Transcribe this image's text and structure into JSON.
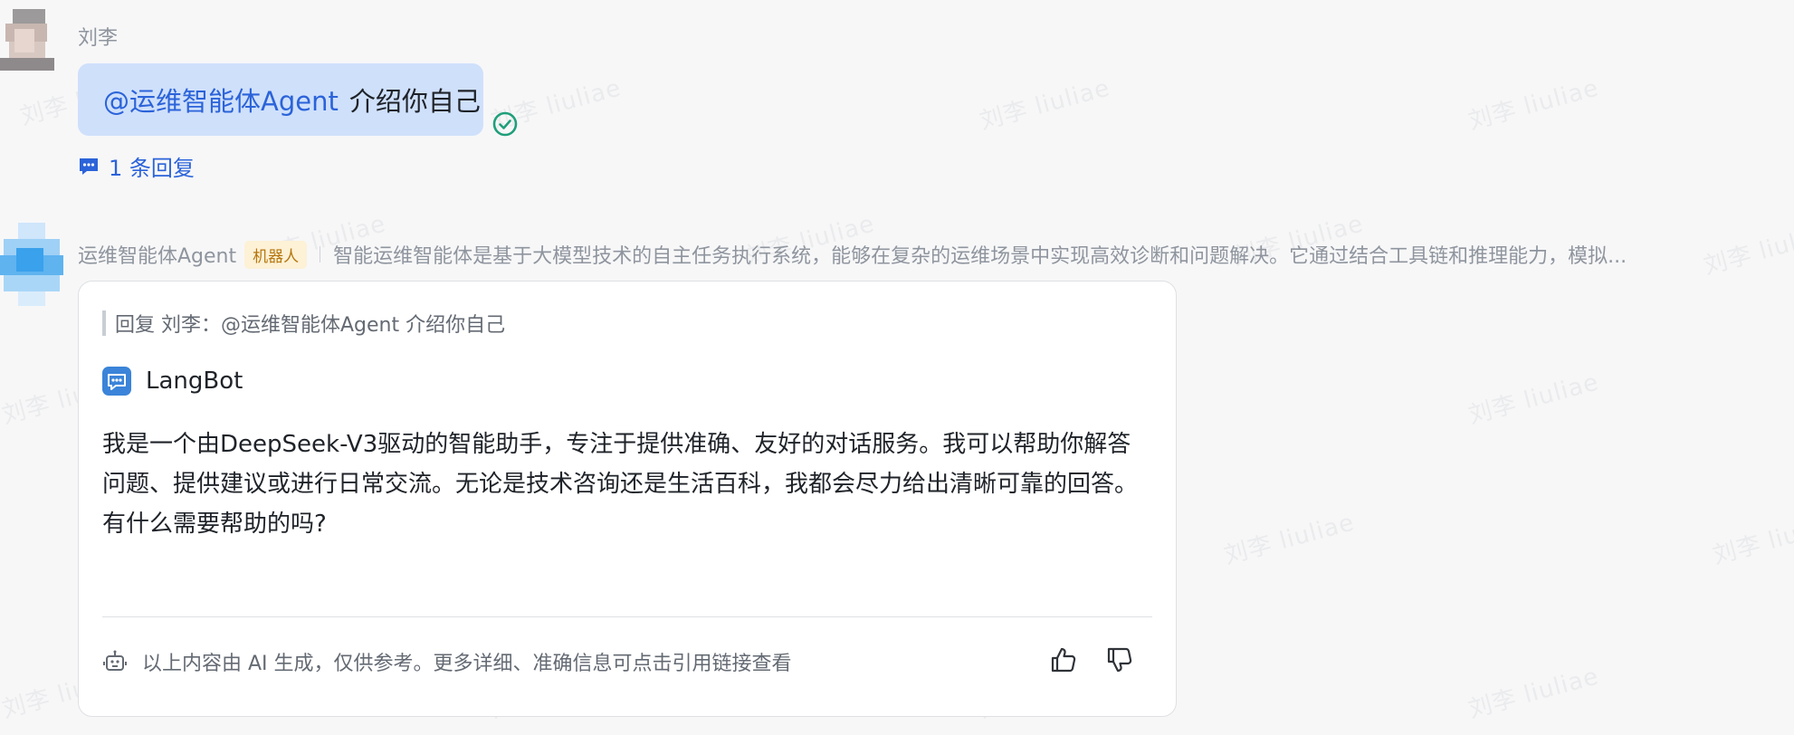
{
  "watermark": "刘李 liuliae",
  "message_user": {
    "sender": "刘李",
    "mention": "@运维智能体Agent",
    "text": "介绍你自己",
    "reply_count_label": "1 条回复"
  },
  "message_bot": {
    "name": "运维智能体Agent",
    "tag": "机器人",
    "preview": "智能运维智能体是基于大模型技术的自主任务执行系统，能够在复杂的运维场景中实现高效诊断和问题解决。它通过结合工具链和推理能力，模拟...",
    "card": {
      "quote": "回复 刘李：@运维智能体Agent 介绍你自己",
      "title": "LangBot",
      "body": "我是一个由DeepSeek-V3驱动的智能助手，专注于提供准确、友好的对话服务。我可以帮助你解答问题、提供建议或进行日常交流。无论是技术咨询还是生活百科，我都会尽力给出清晰可靠的回答。有什么需要帮助的吗?",
      "disclaimer": "以上内容由 AI 生成，仅供参考。更多详细、准确信息可点击引用链接查看"
    }
  },
  "colors": {
    "accent": "#2b63d9",
    "bubble": "#cfe0fb",
    "read_check": "#1f9f7a",
    "tag_bg": "#fdf1d6",
    "tag_text": "#b5770f"
  },
  "icons": {
    "read": "check-circle-icon",
    "reply": "chat-bubble-icon",
    "bot": "bot-chat-icon",
    "robot": "robot-icon",
    "like": "thumbs-up-icon",
    "dislike": "thumbs-down-icon"
  }
}
